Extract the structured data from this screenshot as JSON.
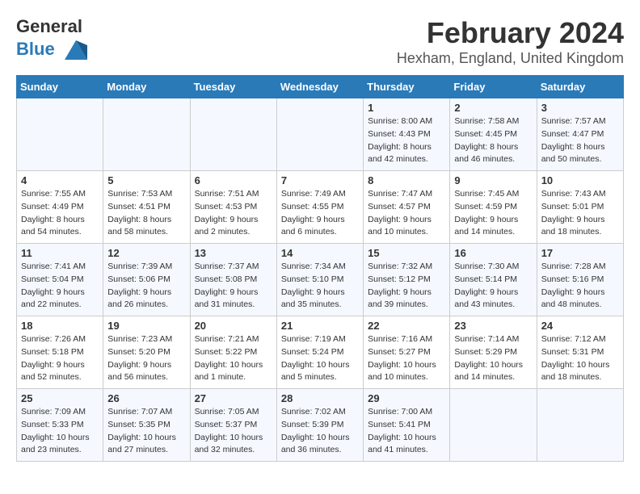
{
  "header": {
    "logo_general": "General",
    "logo_blue": "Blue",
    "title": "February 2024",
    "subtitle": "Hexham, England, United Kingdom"
  },
  "days_of_week": [
    "Sunday",
    "Monday",
    "Tuesday",
    "Wednesday",
    "Thursday",
    "Friday",
    "Saturday"
  ],
  "weeks": [
    [
      {
        "day": "",
        "info": ""
      },
      {
        "day": "",
        "info": ""
      },
      {
        "day": "",
        "info": ""
      },
      {
        "day": "",
        "info": ""
      },
      {
        "day": "1",
        "info": "Sunrise: 8:00 AM\nSunset: 4:43 PM\nDaylight: 8 hours\nand 42 minutes."
      },
      {
        "day": "2",
        "info": "Sunrise: 7:58 AM\nSunset: 4:45 PM\nDaylight: 8 hours\nand 46 minutes."
      },
      {
        "day": "3",
        "info": "Sunrise: 7:57 AM\nSunset: 4:47 PM\nDaylight: 8 hours\nand 50 minutes."
      }
    ],
    [
      {
        "day": "4",
        "info": "Sunrise: 7:55 AM\nSunset: 4:49 PM\nDaylight: 8 hours\nand 54 minutes."
      },
      {
        "day": "5",
        "info": "Sunrise: 7:53 AM\nSunset: 4:51 PM\nDaylight: 8 hours\nand 58 minutes."
      },
      {
        "day": "6",
        "info": "Sunrise: 7:51 AM\nSunset: 4:53 PM\nDaylight: 9 hours\nand 2 minutes."
      },
      {
        "day": "7",
        "info": "Sunrise: 7:49 AM\nSunset: 4:55 PM\nDaylight: 9 hours\nand 6 minutes."
      },
      {
        "day": "8",
        "info": "Sunrise: 7:47 AM\nSunset: 4:57 PM\nDaylight: 9 hours\nand 10 minutes."
      },
      {
        "day": "9",
        "info": "Sunrise: 7:45 AM\nSunset: 4:59 PM\nDaylight: 9 hours\nand 14 minutes."
      },
      {
        "day": "10",
        "info": "Sunrise: 7:43 AM\nSunset: 5:01 PM\nDaylight: 9 hours\nand 18 minutes."
      }
    ],
    [
      {
        "day": "11",
        "info": "Sunrise: 7:41 AM\nSunset: 5:04 PM\nDaylight: 9 hours\nand 22 minutes."
      },
      {
        "day": "12",
        "info": "Sunrise: 7:39 AM\nSunset: 5:06 PM\nDaylight: 9 hours\nand 26 minutes."
      },
      {
        "day": "13",
        "info": "Sunrise: 7:37 AM\nSunset: 5:08 PM\nDaylight: 9 hours\nand 31 minutes."
      },
      {
        "day": "14",
        "info": "Sunrise: 7:34 AM\nSunset: 5:10 PM\nDaylight: 9 hours\nand 35 minutes."
      },
      {
        "day": "15",
        "info": "Sunrise: 7:32 AM\nSunset: 5:12 PM\nDaylight: 9 hours\nand 39 minutes."
      },
      {
        "day": "16",
        "info": "Sunrise: 7:30 AM\nSunset: 5:14 PM\nDaylight: 9 hours\nand 43 minutes."
      },
      {
        "day": "17",
        "info": "Sunrise: 7:28 AM\nSunset: 5:16 PM\nDaylight: 9 hours\nand 48 minutes."
      }
    ],
    [
      {
        "day": "18",
        "info": "Sunrise: 7:26 AM\nSunset: 5:18 PM\nDaylight: 9 hours\nand 52 minutes."
      },
      {
        "day": "19",
        "info": "Sunrise: 7:23 AM\nSunset: 5:20 PM\nDaylight: 9 hours\nand 56 minutes."
      },
      {
        "day": "20",
        "info": "Sunrise: 7:21 AM\nSunset: 5:22 PM\nDaylight: 10 hours\nand 1 minute."
      },
      {
        "day": "21",
        "info": "Sunrise: 7:19 AM\nSunset: 5:24 PM\nDaylight: 10 hours\nand 5 minutes."
      },
      {
        "day": "22",
        "info": "Sunrise: 7:16 AM\nSunset: 5:27 PM\nDaylight: 10 hours\nand 10 minutes."
      },
      {
        "day": "23",
        "info": "Sunrise: 7:14 AM\nSunset: 5:29 PM\nDaylight: 10 hours\nand 14 minutes."
      },
      {
        "day": "24",
        "info": "Sunrise: 7:12 AM\nSunset: 5:31 PM\nDaylight: 10 hours\nand 18 minutes."
      }
    ],
    [
      {
        "day": "25",
        "info": "Sunrise: 7:09 AM\nSunset: 5:33 PM\nDaylight: 10 hours\nand 23 minutes."
      },
      {
        "day": "26",
        "info": "Sunrise: 7:07 AM\nSunset: 5:35 PM\nDaylight: 10 hours\nand 27 minutes."
      },
      {
        "day": "27",
        "info": "Sunrise: 7:05 AM\nSunset: 5:37 PM\nDaylight: 10 hours\nand 32 minutes."
      },
      {
        "day": "28",
        "info": "Sunrise: 7:02 AM\nSunset: 5:39 PM\nDaylight: 10 hours\nand 36 minutes."
      },
      {
        "day": "29",
        "info": "Sunrise: 7:00 AM\nSunset: 5:41 PM\nDaylight: 10 hours\nand 41 minutes."
      },
      {
        "day": "",
        "info": ""
      },
      {
        "day": "",
        "info": ""
      }
    ]
  ]
}
